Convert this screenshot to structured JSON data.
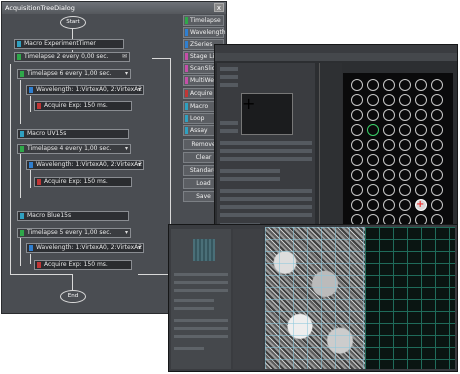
{
  "dialog": {
    "title": "AcquisitionTreeDialog",
    "close_glyph": "x",
    "start_label": "Start",
    "end_label": "End",
    "nodes": [
      {
        "label": "Macro ExperimentTimer"
      },
      {
        "label": "Timelapse 2  every 0,00 sec.",
        "icon": "envelope-icon"
      },
      {
        "label": "Timelapse 6  every 1,00 sec."
      },
      {
        "label": "Wavelength: 1:VirtexA0, 2:VirtexA2"
      },
      {
        "label": "Acquire Exp:  150 ms."
      },
      {
        "label": "Macro UV15s"
      },
      {
        "label": "Timelapse 4  every 1,00 sec."
      },
      {
        "label": "Wavelength: 1:VirtexA0, 2:VirtexA2"
      },
      {
        "label": "Acquire Exp:  150 ms."
      },
      {
        "label": "Macro Blue15s"
      },
      {
        "label": "Timelapse 5  every 1,00 sec."
      },
      {
        "label": "Wavelength: 1:VirtexA0, 2:VirtexA2"
      },
      {
        "label": "Acquire Exp:  150 ms."
      }
    ],
    "side_buttons": [
      {
        "label": "Timelapse",
        "color": "#2fa84a"
      },
      {
        "label": "Wavelength",
        "color": "#2f7fd0"
      },
      {
        "label": "ZSeries",
        "color": "#2f7fd0"
      },
      {
        "label": "Stage List",
        "color": "#c44ea8"
      },
      {
        "label": "ScanSlide",
        "color": "#c44ea8"
      },
      {
        "label": "MultiWell",
        "color": "#c44ea8"
      },
      {
        "label": "Acquire",
        "color": "#c03636"
      },
      {
        "label": "Macro",
        "color": "#2fa0c0"
      },
      {
        "label": "Loop",
        "color": "#2fa0c0"
      },
      {
        "label": "Assay",
        "color": "#2fa0c0"
      },
      {
        "label": "Remove"
      },
      {
        "label": "Clear"
      },
      {
        "label": "Standard"
      },
      {
        "label": "Load"
      },
      {
        "label": "Save"
      }
    ]
  },
  "colors": {
    "timelapse": "#2fa84a",
    "wavelength": "#2f7fd0",
    "acquire": "#c03636",
    "macro": "#2fa0c0",
    "well_active": "#3bd46a",
    "well_marker": "#e33333"
  }
}
